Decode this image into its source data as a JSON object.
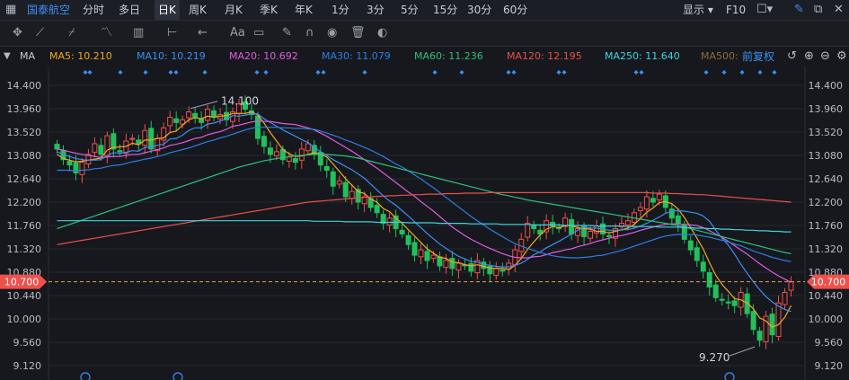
{
  "topbar": {
    "stock_name": "国泰航空",
    "periods": [
      "分时",
      "多日",
      "日K",
      "周K",
      "月K",
      "季K",
      "年K",
      "1分",
      "3分",
      "5分",
      "15分",
      "30分",
      "60分"
    ],
    "active_period": "日K",
    "display_label": "显示",
    "f10_label": "F10"
  },
  "toolbar": {
    "tools": [
      {
        "name": "crosshair-tool-icon",
        "glyph": "✥"
      },
      {
        "name": "line-tool-icon",
        "glyph": "⟋"
      },
      {
        "name": "channel-tool-icon",
        "glyph": "⌿"
      },
      {
        "name": "wave-tool-icon",
        "glyph": "〽"
      },
      {
        "name": "fib-tool-icon",
        "glyph": "▥"
      },
      {
        "name": "range-tool-icon",
        "glyph": "⊢"
      },
      {
        "name": "arrow-tool-icon",
        "glyph": "←"
      },
      {
        "name": "text-tool-icon",
        "glyph": "Aa"
      },
      {
        "name": "note-tool-icon",
        "glyph": "▭"
      },
      {
        "name": "pen-tool-icon",
        "glyph": "✎"
      },
      {
        "name": "magnet-tool-icon",
        "glyph": "∩"
      },
      {
        "name": "eye-tool-icon",
        "glyph": "◉"
      },
      {
        "name": "trash-tool-icon",
        "glyph": "🗑"
      },
      {
        "name": "toggle-tool-icon",
        "glyph": "◐"
      }
    ]
  },
  "mabar": {
    "indicator": "MA",
    "items": [
      {
        "label": "MA5: 10.210",
        "color": "#f5a623"
      },
      {
        "label": "MA10: 10.219",
        "color": "#3d8ef5"
      },
      {
        "label": "MA20: 10.692",
        "color": "#e05ce0"
      },
      {
        "label": "MA30: 11.079",
        "color": "#2f7de1"
      },
      {
        "label": "MA60: 11.236",
        "color": "#2ec07a"
      },
      {
        "label": "MA120: 12.195",
        "color": "#e8504a"
      },
      {
        "label": "MA250: 11.640",
        "color": "#3fd4e0"
      },
      {
        "label": "MA500:",
        "color": "#8a6d3b"
      }
    ],
    "adjust_label": "前复权"
  },
  "chart_data": {
    "type": "candlestick",
    "y_ticks": [
      14.4,
      13.96,
      13.52,
      13.08,
      12.64,
      12.2,
      11.76,
      11.32,
      10.88,
      10.44,
      10.0,
      9.56,
      9.12
    ],
    "ylim": [
      9.1,
      14.5
    ],
    "current_price": 10.7,
    "annotations": [
      {
        "label": "14.100",
        "kind": "high"
      },
      {
        "label": "9.270",
        "kind": "low"
      }
    ],
    "colors": {
      "up": "#f0504a",
      "down": "#22c05c",
      "bg": "#16181d",
      "grid": "#252830"
    },
    "close": [
      13.2,
      13.0,
      12.9,
      12.75,
      12.95,
      13.1,
      13.3,
      13.1,
      13.45,
      13.2,
      13.15,
      13.35,
      13.4,
      13.3,
      13.55,
      13.2,
      13.4,
      13.6,
      13.8,
      13.7,
      13.75,
      13.9,
      13.8,
      13.7,
      13.95,
      13.8,
      13.85,
      13.75,
      13.9,
      14.05,
      13.95,
      13.85,
      13.4,
      13.25,
      13.1,
      13.15,
      13.0,
      13.05,
      12.95,
      13.2,
      13.3,
      13.1,
      12.9,
      12.8,
      12.5,
      12.6,
      12.3,
      12.4,
      12.2,
      12.3,
      12.1,
      12.0,
      11.8,
      11.9,
      11.7,
      11.6,
      11.4,
      11.2,
      11.3,
      11.1,
      11.2,
      11.0,
      11.1,
      10.95,
      11.05,
      11.0,
      10.9,
      11.1,
      10.95,
      10.85,
      10.95,
      10.9,
      11.05,
      11.3,
      11.5,
      11.8,
      11.7,
      11.6,
      11.85,
      11.75,
      11.7,
      11.9,
      11.6,
      11.7,
      11.55,
      11.65,
      11.75,
      11.6,
      11.55,
      11.7,
      11.8,
      11.85,
      12.0,
      12.1,
      12.3,
      12.2,
      12.35,
      12.1,
      11.9,
      11.8,
      11.5,
      11.3,
      11.1,
      10.9,
      10.6,
      10.4,
      10.35,
      10.3,
      10.25,
      10.5,
      10.1,
      9.8,
      9.6,
      10.05,
      9.7,
      10.3,
      10.5,
      10.7
    ],
    "ma_series": [
      {
        "name": "MA5",
        "color": "#f5a623",
        "values": [
          13.1,
          13.02,
          12.99,
          12.96,
          12.97,
          12.99,
          13.01,
          13.03,
          13.18,
          13.23,
          13.24,
          13.25,
          13.31,
          13.28,
          13.37,
          13.37,
          13.4,
          13.41,
          13.51,
          13.54,
          13.65,
          13.75,
          13.79,
          13.77,
          13.82,
          13.8,
          13.82,
          13.83,
          13.87,
          13.87,
          13.87,
          13.9,
          13.84,
          13.69,
          13.51,
          13.35,
          13.19,
          13.11,
          13.06,
          13.07,
          13.1,
          13.13,
          13.1,
          13.05,
          12.92,
          12.78,
          12.64,
          12.52,
          12.4,
          12.36,
          12.26,
          12.2,
          12.08,
          12.02,
          11.9,
          11.8,
          11.68,
          11.56,
          11.44,
          11.32,
          11.24,
          11.16,
          11.14,
          11.07,
          11.06,
          11.02,
          11.0,
          11.02,
          10.99,
          10.96,
          10.95,
          10.95,
          10.93,
          11.01,
          11.14,
          11.31,
          11.45,
          11.58,
          11.69,
          11.74,
          11.72,
          11.76,
          11.76,
          11.72,
          11.7,
          11.69,
          11.65,
          11.65,
          11.62,
          11.65,
          11.68,
          11.71,
          11.78,
          11.89,
          12.01,
          12.09,
          12.19,
          12.21,
          12.17,
          12.07,
          11.91,
          11.72,
          11.52,
          11.32,
          11.06,
          10.82,
          10.65,
          10.52,
          10.38,
          10.36,
          10.3,
          10.19,
          10.02,
          9.96,
          9.85,
          9.89,
          10.03,
          10.25
        ]
      },
      {
        "name": "MA10",
        "color": "#3d8ef5",
        "values": [
          13.15,
          13.1,
          13.06,
          13.02,
          13.0,
          12.99,
          12.99,
          13.0,
          13.08,
          13.13,
          13.12,
          13.14,
          13.17,
          13.16,
          13.23,
          13.24,
          13.27,
          13.29,
          13.39,
          13.4,
          13.46,
          13.55,
          13.6,
          13.6,
          13.67,
          13.69,
          13.73,
          13.76,
          13.83,
          13.82,
          13.84,
          13.86,
          13.86,
          13.77,
          13.7,
          13.63,
          13.56,
          13.5,
          13.44,
          13.38,
          13.32,
          13.23,
          13.15,
          13.08,
          13.0,
          12.94,
          12.87,
          12.81,
          12.73,
          12.65,
          12.54,
          12.43,
          12.32,
          12.22,
          12.14,
          12.04,
          11.94,
          11.83,
          11.72,
          11.61,
          11.51,
          11.41,
          11.33,
          11.25,
          11.18,
          11.13,
          11.08,
          11.07,
          11.03,
          11.01,
          10.99,
          10.98,
          10.98,
          11.01,
          11.05,
          11.12,
          11.21,
          11.26,
          11.34,
          11.4,
          11.46,
          11.53,
          11.6,
          11.67,
          11.73,
          11.71,
          11.71,
          11.69,
          11.67,
          11.67,
          11.68,
          11.68,
          11.71,
          11.75,
          11.8,
          11.86,
          11.92,
          11.99,
          12.03,
          12.04,
          12.03,
          12.01,
          11.99,
          11.94,
          11.84,
          11.67,
          11.52,
          11.39,
          11.22,
          11.03,
          10.86,
          10.7,
          10.55,
          10.42,
          10.32,
          10.24,
          10.18,
          10.14
        ]
      },
      {
        "name": "MA20",
        "color": "#e05ce0",
        "values": [
          13.2,
          13.18,
          13.15,
          13.12,
          13.1,
          13.08,
          13.06,
          13.04,
          13.05,
          13.06,
          13.06,
          13.08,
          13.1,
          13.1,
          13.13,
          13.16,
          13.19,
          13.22,
          13.27,
          13.29,
          13.32,
          13.36,
          13.4,
          13.42,
          13.47,
          13.5,
          13.53,
          13.57,
          13.63,
          13.65,
          13.68,
          13.71,
          13.73,
          13.72,
          13.72,
          13.7,
          13.68,
          13.67,
          13.66,
          13.63,
          13.6,
          13.56,
          13.5,
          13.44,
          13.37,
          13.3,
          13.23,
          13.16,
          13.08,
          13.0,
          12.92,
          12.84,
          12.75,
          12.66,
          12.57,
          12.48,
          12.39,
          12.31,
          12.21,
          12.12,
          12.03,
          11.93,
          11.83,
          11.73,
          11.65,
          11.57,
          11.5,
          11.44,
          11.38,
          11.33,
          11.28,
          11.23,
          11.19,
          11.16,
          11.15,
          11.15,
          11.17,
          11.18,
          11.21,
          11.25,
          11.27,
          11.3,
          11.32,
          11.36,
          11.39,
          11.42,
          11.46,
          11.49,
          11.52,
          11.55,
          11.57,
          11.6,
          11.63,
          11.67,
          11.7,
          11.73,
          11.76,
          11.78,
          11.79,
          11.79,
          11.78,
          11.77,
          11.76,
          11.72,
          11.66,
          11.6,
          11.54,
          11.46,
          11.38,
          11.3,
          11.22,
          11.13,
          11.04,
          10.96,
          10.88,
          10.81,
          10.75,
          10.69
        ]
      },
      {
        "name": "MA30",
        "color": "#2f7de1",
        "values": [
          12.8,
          12.8,
          12.8,
          12.79,
          12.8,
          12.81,
          12.83,
          12.84,
          12.87,
          12.89,
          12.9,
          12.93,
          12.96,
          12.98,
          13.01,
          13.03,
          13.06,
          13.09,
          13.13,
          13.16,
          13.19,
          13.22,
          13.26,
          13.3,
          13.34,
          13.37,
          13.41,
          13.44,
          13.48,
          13.52,
          13.56,
          13.59,
          13.61,
          13.61,
          13.61,
          13.61,
          13.6,
          13.6,
          13.59,
          13.59,
          13.58,
          13.57,
          13.54,
          13.5,
          13.46,
          13.42,
          13.37,
          13.33,
          13.28,
          13.23,
          13.18,
          13.12,
          13.06,
          12.99,
          12.92,
          12.86,
          12.79,
          12.71,
          12.64,
          12.55,
          12.47,
          12.38,
          12.29,
          12.2,
          12.11,
          12.02,
          11.93,
          11.85,
          11.77,
          11.69,
          11.62,
          11.55,
          11.48,
          11.42,
          11.37,
          11.33,
          11.29,
          11.25,
          11.22,
          11.19,
          11.17,
          11.16,
          11.15,
          11.15,
          11.16,
          11.17,
          11.19,
          11.2,
          11.23,
          11.26,
          11.29,
          11.33,
          11.37,
          11.41,
          11.45,
          11.49,
          11.53,
          11.56,
          11.58,
          11.59,
          11.59,
          11.59,
          11.58,
          11.56,
          11.54,
          11.51,
          11.48,
          11.45,
          11.41,
          11.38,
          11.33,
          11.28,
          11.24,
          11.2,
          11.16,
          11.13,
          11.1,
          11.08
        ]
      },
      {
        "name": "MA60",
        "color": "#2ec07a",
        "values": [
          11.7,
          11.74,
          11.78,
          11.82,
          11.86,
          11.9,
          11.94,
          11.98,
          12.02,
          12.06,
          12.1,
          12.14,
          12.18,
          12.22,
          12.26,
          12.3,
          12.34,
          12.38,
          12.42,
          12.46,
          12.5,
          12.54,
          12.58,
          12.62,
          12.66,
          12.7,
          12.74,
          12.78,
          12.82,
          12.86,
          12.89,
          12.92,
          12.95,
          12.98,
          13.0,
          13.02,
          13.04,
          13.06,
          13.07,
          13.08,
          13.09,
          13.1,
          13.1,
          13.1,
          13.09,
          13.08,
          13.07,
          13.05,
          13.03,
          13.0,
          12.97,
          12.94,
          12.91,
          12.88,
          12.85,
          12.82,
          12.79,
          12.76,
          12.73,
          12.7,
          12.67,
          12.64,
          12.61,
          12.58,
          12.55,
          12.52,
          12.49,
          12.46,
          12.43,
          12.4,
          12.37,
          12.34,
          12.32,
          12.29,
          12.27,
          12.24,
          12.22,
          12.2,
          12.18,
          12.16,
          12.14,
          12.12,
          12.1,
          12.08,
          12.06,
          12.04,
          12.02,
          12.0,
          11.98,
          11.96,
          11.94,
          11.92,
          11.9,
          11.88,
          11.86,
          11.84,
          11.82,
          11.8,
          11.78,
          11.76,
          11.73,
          11.7,
          11.67,
          11.64,
          11.61,
          11.58,
          11.55,
          11.52,
          11.49,
          11.46,
          11.43,
          11.4,
          11.37,
          11.34,
          11.31,
          11.28,
          11.25,
          11.23
        ]
      },
      {
        "name": "MA120",
        "color": "#e8504a",
        "values": [
          11.4,
          11.42,
          11.44,
          11.46,
          11.48,
          11.5,
          11.52,
          11.54,
          11.56,
          11.58,
          11.6,
          11.62,
          11.64,
          11.66,
          11.68,
          11.7,
          11.72,
          11.74,
          11.76,
          11.78,
          11.8,
          11.82,
          11.84,
          11.86,
          11.88,
          11.9,
          11.92,
          11.94,
          11.96,
          11.98,
          12.0,
          12.02,
          12.04,
          12.06,
          12.08,
          12.1,
          12.12,
          12.14,
          12.16,
          12.18,
          12.2,
          12.21,
          12.22,
          12.23,
          12.24,
          12.25,
          12.26,
          12.27,
          12.28,
          12.29,
          12.3,
          12.31,
          12.31,
          12.32,
          12.32,
          12.33,
          12.33,
          12.34,
          12.34,
          12.35,
          12.35,
          12.35,
          12.36,
          12.36,
          12.36,
          12.37,
          12.37,
          12.37,
          12.37,
          12.38,
          12.38,
          12.38,
          12.38,
          12.38,
          12.38,
          12.38,
          12.38,
          12.38,
          12.38,
          12.38,
          12.38,
          12.38,
          12.38,
          12.38,
          12.38,
          12.38,
          12.38,
          12.38,
          12.38,
          12.38,
          12.38,
          12.38,
          12.38,
          12.38,
          12.38,
          12.37,
          12.37,
          12.37,
          12.36,
          12.36,
          12.35,
          12.35,
          12.34,
          12.34,
          12.33,
          12.32,
          12.31,
          12.3,
          12.29,
          12.28,
          12.27,
          12.26,
          12.25,
          12.24,
          12.23,
          12.22,
          12.21,
          12.2
        ]
      },
      {
        "name": "MA250",
        "color": "#3fd4e0",
        "values": [
          11.85,
          11.85,
          11.85,
          11.85,
          11.85,
          11.85,
          11.85,
          11.85,
          11.85,
          11.85,
          11.85,
          11.85,
          11.85,
          11.85,
          11.85,
          11.85,
          11.85,
          11.85,
          11.85,
          11.85,
          11.85,
          11.85,
          11.85,
          11.85,
          11.85,
          11.85,
          11.85,
          11.85,
          11.85,
          11.85,
          11.85,
          11.85,
          11.85,
          11.85,
          11.85,
          11.85,
          11.85,
          11.85,
          11.85,
          11.85,
          11.85,
          11.84,
          11.84,
          11.84,
          11.84,
          11.84,
          11.83,
          11.83,
          11.83,
          11.83,
          11.83,
          11.82,
          11.82,
          11.82,
          11.82,
          11.82,
          11.81,
          11.81,
          11.81,
          11.81,
          11.81,
          11.8,
          11.8,
          11.8,
          11.8,
          11.8,
          11.79,
          11.79,
          11.79,
          11.79,
          11.79,
          11.78,
          11.78,
          11.78,
          11.78,
          11.78,
          11.77,
          11.77,
          11.77,
          11.77,
          11.77,
          11.76,
          11.76,
          11.76,
          11.76,
          11.76,
          11.75,
          11.75,
          11.75,
          11.75,
          11.75,
          11.74,
          11.74,
          11.74,
          11.74,
          11.74,
          11.73,
          11.73,
          11.73,
          11.73,
          11.72,
          11.72,
          11.71,
          11.71,
          11.7,
          11.7,
          11.69,
          11.69,
          11.68,
          11.68,
          11.67,
          11.67,
          11.66,
          11.66,
          11.65,
          11.65,
          11.64,
          11.64
        ]
      }
    ]
  }
}
